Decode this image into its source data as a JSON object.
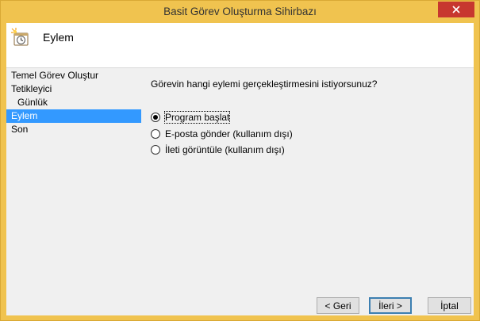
{
  "window": {
    "title": "Basit Görev Oluşturma Sihirbazı"
  },
  "header": {
    "title": "Eylem",
    "icon": "task-scheduler-icon"
  },
  "sidebar": {
    "steps": [
      {
        "label": "Temel Görev Oluştur",
        "selected": false
      },
      {
        "label": "Tetikleyici",
        "selected": false
      },
      {
        "label": "Günlük",
        "selected": false
      },
      {
        "label": "Eylem",
        "selected": true
      },
      {
        "label": "Son",
        "selected": false
      }
    ]
  },
  "main": {
    "question": "Görevin hangi eylemi gerçekleştirmesini istiyorsunuz?",
    "options": [
      {
        "label": "Program başlat",
        "checked": true
      },
      {
        "label": "E-posta gönder (kullanım dışı)",
        "checked": false
      },
      {
        "label": "İleti görüntüle (kullanım dışı)",
        "checked": false
      }
    ]
  },
  "buttons": {
    "back": "< Geri",
    "next": "İleri >",
    "cancel": "İptal"
  },
  "colors": {
    "titlebar": "#f0c34f",
    "selected": "#3399ff",
    "close": "#c7372f"
  }
}
